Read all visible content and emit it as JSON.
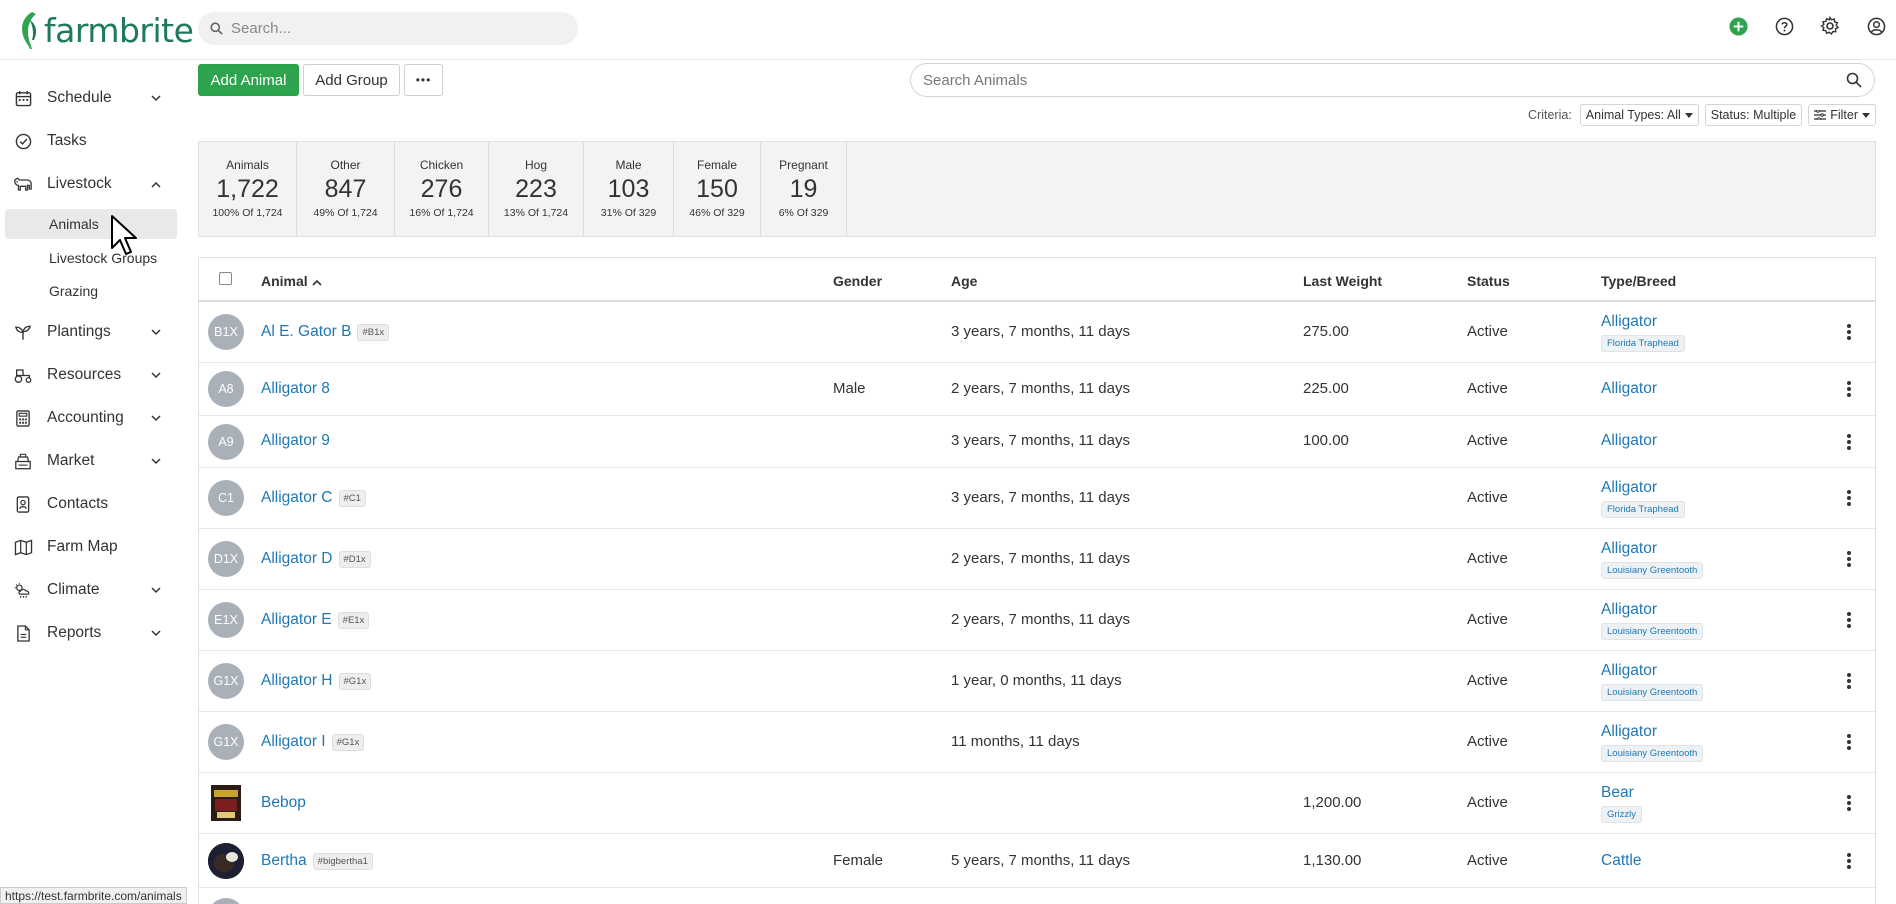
{
  "app": {
    "logo_text": "farmbrite",
    "search_placeholder": "Search...",
    "status_url": "https://test.farmbrite.com/animals"
  },
  "topbar_icons": [
    "add-circle-icon",
    "help-icon",
    "gear-icon",
    "user-icon"
  ],
  "sidebar": {
    "items": [
      {
        "label": "Schedule",
        "icon": "calendar-icon",
        "expandable": true
      },
      {
        "label": "Tasks",
        "icon": "check-circle-icon",
        "expandable": false
      },
      {
        "label": "Livestock",
        "icon": "cow-icon",
        "expandable": true,
        "expanded": true
      },
      {
        "label": "Plantings",
        "icon": "sprout-icon",
        "expandable": true
      },
      {
        "label": "Resources",
        "icon": "tractor-icon",
        "expandable": true
      },
      {
        "label": "Accounting",
        "icon": "calculator-icon",
        "expandable": true
      },
      {
        "label": "Market",
        "icon": "cash-register-icon",
        "expandable": true
      },
      {
        "label": "Contacts",
        "icon": "contact-book-icon",
        "expandable": false
      },
      {
        "label": "Farm Map",
        "icon": "map-icon",
        "expandable": false
      },
      {
        "label": "Climate",
        "icon": "weather-icon",
        "expandable": true
      },
      {
        "label": "Reports",
        "icon": "report-icon",
        "expandable": true
      }
    ],
    "livestock_sub": [
      {
        "label": "Animals",
        "active": true
      },
      {
        "label": "Livestock Groups",
        "active": false
      },
      {
        "label": "Grazing",
        "active": false
      }
    ]
  },
  "toolbar": {
    "add_animal": "Add Animal",
    "add_group": "Add Group",
    "more": "•••",
    "search_placeholder": "Search Animals"
  },
  "criteria": {
    "label": "Criteria:",
    "animal_types": "Animal Types: All",
    "status": "Status: Multiple",
    "filter": "Filter"
  },
  "stats": [
    {
      "label": "Animals",
      "value": "1,722",
      "sub": "100% Of 1,724"
    },
    {
      "label": "Other",
      "value": "847",
      "sub": "49% Of 1,724"
    },
    {
      "label": "Chicken",
      "value": "276",
      "sub": "16% Of 1,724"
    },
    {
      "label": "Hog",
      "value": "223",
      "sub": "13% Of 1,724"
    },
    {
      "label": "Male",
      "value": "103",
      "sub": "31% Of 329"
    },
    {
      "label": "Female",
      "value": "150",
      "sub": "46% Of 329"
    },
    {
      "label": "Pregnant",
      "value": "19",
      "sub": "6% Of 329"
    }
  ],
  "table": {
    "columns": {
      "animal": "Animal",
      "gender": "Gender",
      "age": "Age",
      "weight": "Last Weight",
      "status": "Status",
      "breed": "Type/Breed"
    },
    "rows": [
      {
        "avatar": "B1X",
        "name": "Al E. Gator B",
        "tag": "#B1x",
        "gender": "",
        "age": "3 years, 7 months, 11 days",
        "weight": "275.00",
        "status": "Active",
        "type": "Alligator",
        "breed": "Florida Traphead"
      },
      {
        "avatar": "A8",
        "name": "Alligator 8",
        "tag": "",
        "gender": "Male",
        "age": "2 years, 7 months, 11 days",
        "weight": "225.00",
        "status": "Active",
        "type": "Alligator",
        "breed": ""
      },
      {
        "avatar": "A9",
        "name": "Alligator 9",
        "tag": "",
        "gender": "",
        "age": "3 years, 7 months, 11 days",
        "weight": "100.00",
        "status": "Active",
        "type": "Alligator",
        "breed": ""
      },
      {
        "avatar": "C1",
        "name": "Alligator C",
        "tag": "#C1",
        "gender": "",
        "age": "3 years, 7 months, 11 days",
        "weight": "",
        "status": "Active",
        "type": "Alligator",
        "breed": "Florida Traphead"
      },
      {
        "avatar": "D1X",
        "name": "Alligator D",
        "tag": "#D1x",
        "gender": "",
        "age": "2 years, 7 months, 11 days",
        "weight": "",
        "status": "Active",
        "type": "Alligator",
        "breed": "Louisiany Greentooth"
      },
      {
        "avatar": "E1X",
        "name": "Alligator E",
        "tag": "#E1x",
        "gender": "",
        "age": "2 years, 7 months, 11 days",
        "weight": "",
        "status": "Active",
        "type": "Alligator",
        "breed": "Louisiany Greentooth"
      },
      {
        "avatar": "G1X",
        "name": "Alligator H",
        "tag": "#G1x",
        "gender": "",
        "age": "1 year, 0 months, 11 days",
        "weight": "",
        "status": "Active",
        "type": "Alligator",
        "breed": "Louisiany Greentooth"
      },
      {
        "avatar": "G1X",
        "name": "Alligator I",
        "tag": "#G1x",
        "gender": "",
        "age": "11 months, 11 days",
        "weight": "",
        "status": "Active",
        "type": "Alligator",
        "breed": "Louisiany Greentooth"
      },
      {
        "avatar": "",
        "name": "Bebop",
        "tag": "",
        "gender": "",
        "age": "",
        "weight": "1,200.00",
        "status": "Active",
        "type": "Bear",
        "breed": "Grizzly"
      },
      {
        "avatar": "",
        "name": "Bertha",
        "tag": "#bigbertha1",
        "gender": "Female",
        "age": "5 years, 7 months, 11 days",
        "weight": "1,130.00",
        "status": "Active",
        "type": "Cattle",
        "breed": ""
      }
    ]
  }
}
